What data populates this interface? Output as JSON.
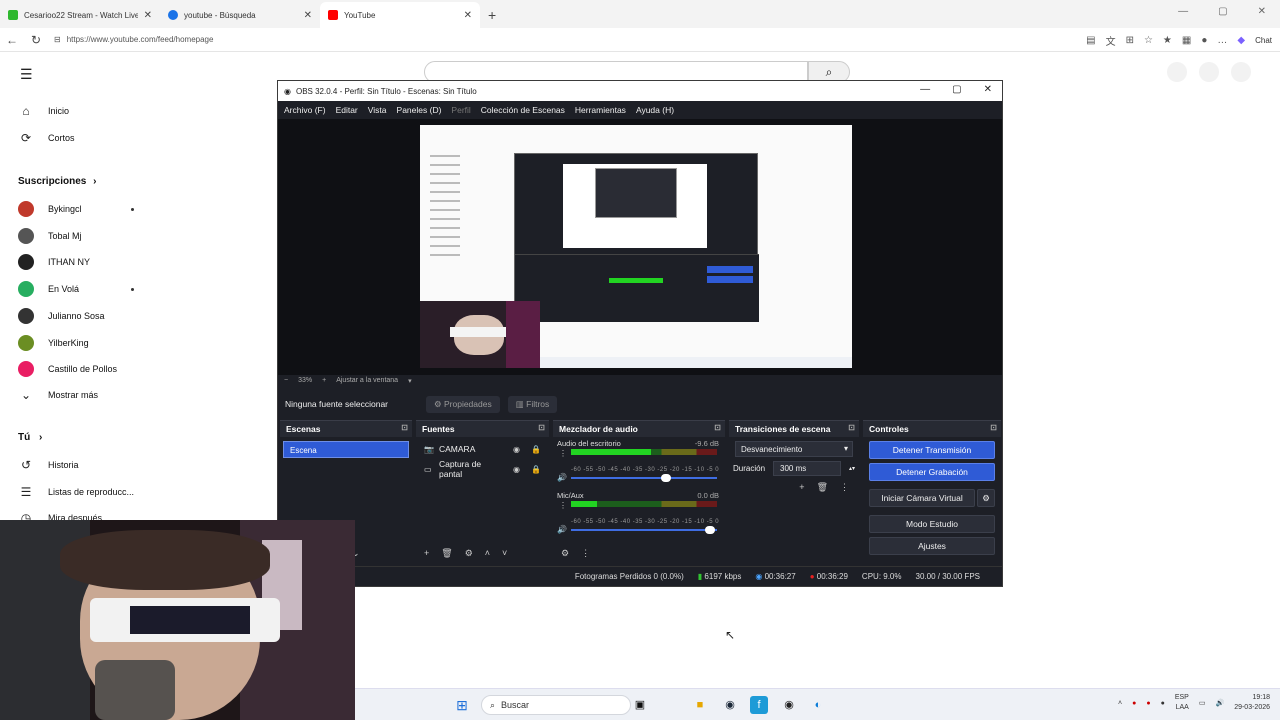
{
  "browser": {
    "tabs": [
      {
        "label": "Cesarioo22 Stream - Watch Live o",
        "color": "#2eb82e"
      },
      {
        "label": "youtube - Búsqueda",
        "color": "#1a73e8"
      },
      {
        "label": "YouTube",
        "color": "#ff0000"
      }
    ],
    "url": "https://www.youtube.com/feed/homepage",
    "chat_label": "Chat"
  },
  "youtube": {
    "nav": [
      {
        "label": "Inicio",
        "icon": "home-icon"
      },
      {
        "label": "Cortos",
        "icon": "shorts-icon"
      }
    ],
    "subscriptions_title": "Suscripciones",
    "subscriptions": [
      {
        "label": "Bykingcl",
        "color": "#c0392b",
        "dot": true
      },
      {
        "label": "Tobal Mj",
        "color": "#555555",
        "dot": false
      },
      {
        "label": "ITHAN NY",
        "color": "#222222",
        "dot": false
      },
      {
        "label": "En Volá",
        "color": "#27ae60",
        "dot": true
      },
      {
        "label": "Julianno Sosa",
        "color": "#333333",
        "dot": false
      },
      {
        "label": "YilberKing",
        "color": "#6b8e23",
        "dot": false
      },
      {
        "label": "Castillo de Pollos",
        "color": "#e91e63",
        "dot": false
      }
    ],
    "show_more": "Mostrar más",
    "you_title": "Tú",
    "you_items": [
      {
        "label": "Historia",
        "icon": "history-icon"
      },
      {
        "label": "Listas de reproducc...",
        "icon": "playlist-icon"
      },
      {
        "label": "Mira después",
        "icon": "watch-later-icon"
      }
    ]
  },
  "obs": {
    "title": "OBS 32.0.4 - Perfil: Sin Título - Escenas: Sin Título",
    "menu": [
      "Archivo (F)",
      "Editar",
      "Vista",
      "Paneles (D)",
      "Perfil",
      "Colección de Escenas",
      "Herramientas",
      "Ayuda (H)"
    ],
    "zoom": "33%",
    "fit_label": "Ajustar a la ventana",
    "no_source": "Ninguna fuente seleccionar",
    "properties": "Propiedades",
    "filters": "Filtros",
    "scenes_title": "Escenas",
    "scene_selected": "Escena",
    "sources_title": "Fuentes",
    "sources": [
      {
        "label": "CAMARA",
        "icon": "camera-icon"
      },
      {
        "label": "Captura de pantal",
        "icon": "monitor-icon"
      }
    ],
    "mixer_title": "Mezclador de audio",
    "mixer": [
      {
        "label": "Audio del escritorio",
        "db": "-9.6 dB",
        "level": 0.55,
        "volume": 0.65
      },
      {
        "label": "Mic/Aux",
        "db": "0.0 dB",
        "level": 0.18,
        "volume": 0.95
      }
    ],
    "mixer_scale": "-60 -55 -50 -45 -40 -35 -30 -25 -20 -15 -10 -5 0",
    "transitions_title": "Transiciones de escena",
    "transition": "Desvanecimiento",
    "duration_label": "Duración",
    "duration_value": "300 ms",
    "controls_title": "Controles",
    "controls": {
      "stop_stream": "Detener Transmisión",
      "stop_record": "Detener Grabación",
      "virtual_cam": "Iniciar Cámara Virtual",
      "studio_mode": "Modo Estudio",
      "settings": "Ajustes"
    },
    "status": {
      "dropped": "Fotogramas Perdidos 0 (0.0%)",
      "bitrate": "6197 kbps",
      "stream_time": "00:36:27",
      "rec_time": "00:36:29",
      "cpu": "CPU: 9.0%",
      "fps": "30.00 / 30.00 FPS"
    }
  },
  "taskbar": {
    "search_placeholder": "Buscar",
    "lang": "ESP",
    "region": "LAA",
    "time": "19:18",
    "date": "29-03-2026"
  }
}
